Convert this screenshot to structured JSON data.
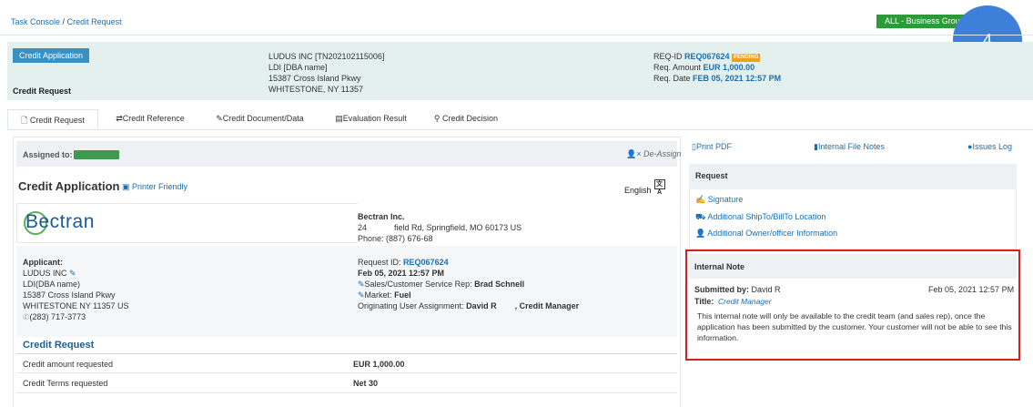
{
  "breadcrumb": {
    "home": "Task Console",
    "sep": "/",
    "current": "Credit Request"
  },
  "business_group": "ALL - Business Group",
  "badge_number": "4",
  "header": {
    "button": "Credit Application",
    "title": "Credit Request",
    "company_lines": [
      "LUDUS INC [TN202102115006]",
      "LDI [DBA name]",
      "15387 Cross Island Pkwy",
      "WHITESTONE, NY 11357"
    ],
    "req_id_label": "REQ-ID",
    "req_id": "REQ067624",
    "status": "PENDING",
    "amount_label": "Req. Amount",
    "amount": "EUR 1,000.00",
    "date_label": "Req. Date",
    "date": "FEB 05, 2021 12:57 PM"
  },
  "tabs": [
    {
      "label": "Credit Request",
      "icon": "document-icon"
    },
    {
      "label": "Credit Reference",
      "icon": "exchange-icon"
    },
    {
      "label": "Credit Document/Data",
      "icon": "pen-icon"
    },
    {
      "label": "Evaluation Result",
      "icon": "list-icon"
    },
    {
      "label": "Credit Decision",
      "icon": "pin-icon"
    }
  ],
  "assigned": {
    "label": "Assigned to:",
    "deassign": "De-Assign"
  },
  "credit_app": {
    "title": "Credit Application",
    "printer": "Printer Friendly",
    "language": "English"
  },
  "logo_text": "Bectran",
  "bectran_info": {
    "name": "Bectran Inc.",
    "address": "24            field Rd, Springfield, MO 60173 US",
    "phone": "Phone: (887) 676-68"
  },
  "applicant": {
    "label": "Applicant:",
    "name": "LUDUS INC",
    "dba": "LDI(DBA name)",
    "street": "15387 Cross Island Pkwy",
    "city": "WHITESTONE NY 11357 US",
    "phone": "(283) 717-3773"
  },
  "request_info": {
    "id_label": "Request ID:",
    "id": "REQ067624",
    "date": "Feb 05, 2021 12:57 PM",
    "rep_label": "Sales/Customer Service Rep:",
    "rep": "Brad Schnell",
    "market_label": "Market:",
    "market": "Fuel",
    "orig_label": "Originating User Assignment:",
    "orig": "David R",
    "orig_role": ", Credit Manager"
  },
  "credit_request": {
    "title": "Credit Request",
    "rows": [
      {
        "label": "Credit amount requested",
        "value": "EUR 1,000.00"
      },
      {
        "label": "Credit Terms requested",
        "value": "Net 30"
      }
    ]
  },
  "right_links": {
    "print": "Print PDF",
    "file_notes": "Internal File Notes",
    "issues": "Issues Log"
  },
  "request_panel": {
    "title": "Request",
    "links": [
      "Signature",
      "Additional ShipTo/BillTo Location",
      "Additional Owner/officer Information"
    ]
  },
  "internal_note": {
    "title": "Internal Note",
    "submitted_label": "Submitted by:",
    "submitted_by": "David R",
    "date": "Feb 05, 2021 12:57 PM",
    "title_label": "Title:",
    "role": "Credit Manager",
    "text": "This internal note will only be available to the credit team (and sales rep), once the application has been submitted by the customer. Your customer will not be able to see this information."
  }
}
